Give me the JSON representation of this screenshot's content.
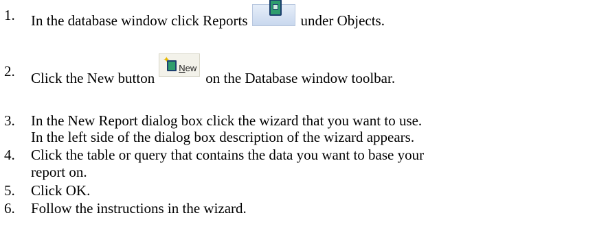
{
  "steps": [
    {
      "num": "1.",
      "before": "In the database window click Reports",
      "icon": "reports-icon",
      "after": "under Objects."
    },
    {
      "num": "2.",
      "before": "Click the New button",
      "icon": "new-report-icon",
      "button_label_first": "N",
      "button_label_rest": "ew",
      "after": "on the Database window toolbar."
    },
    {
      "num": "3.",
      "line1": "In the New Report dialog box click the wizard that you want to use.",
      "line2": "In the left side of the dialog box description of the wizard appears."
    },
    {
      "num": "4.",
      "line1": "Click the table or query that contains the data you want to base your",
      "line2": "report on."
    },
    {
      "num": "5.",
      "line1": "Click OK."
    },
    {
      "num": "6.",
      "line1": "Follow the instructions in the wizard."
    }
  ]
}
